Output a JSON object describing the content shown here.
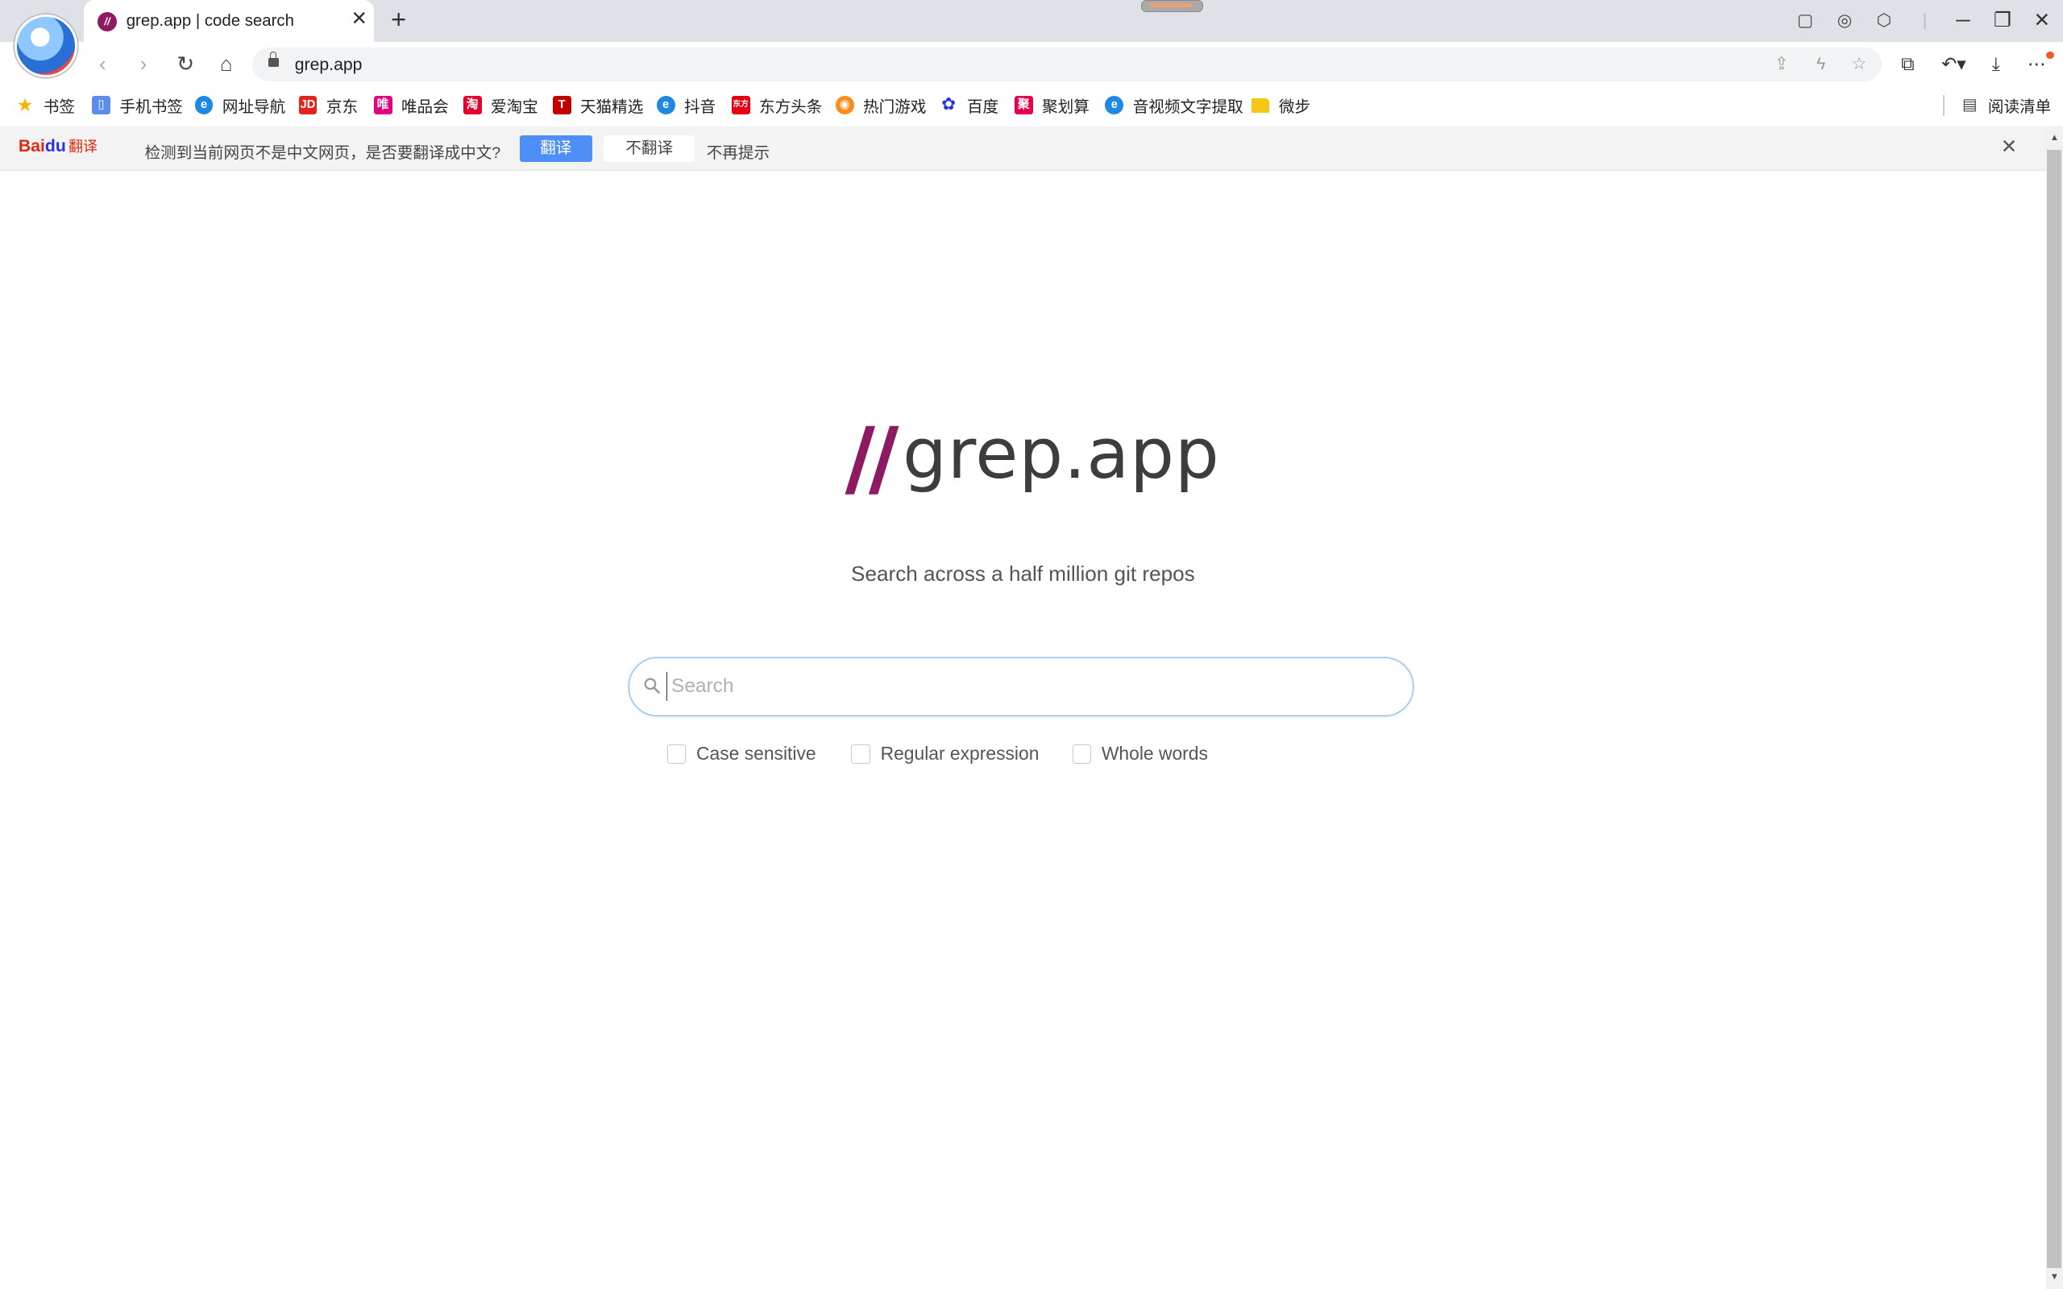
{
  "browser": {
    "tab": {
      "title": "grep.app | code search",
      "favicon_text": "//"
    },
    "url": "grep.app",
    "reading_list_label": "阅读清单"
  },
  "bookmarks": [
    {
      "label": "书签",
      "icon": "star-icon",
      "color": "#f5b400"
    },
    {
      "label": "手机书签",
      "icon": "phone-icon",
      "color": "#5b8def"
    },
    {
      "label": "网址导航",
      "icon": "ie-icon",
      "color": "#1e88e5"
    },
    {
      "label": "京东",
      "icon": "jd-icon",
      "color": "#e1251b"
    },
    {
      "label": "唯品会",
      "icon": "vip-icon",
      "color": "#e5007f"
    },
    {
      "label": "爱淘宝",
      "icon": "taobao-icon",
      "color": "#e4002b"
    },
    {
      "label": "天猫精选",
      "icon": "tmall-icon",
      "color": "#c40000"
    },
    {
      "label": "抖音",
      "icon": "ie-icon",
      "color": "#1e88e5"
    },
    {
      "label": "东方头条",
      "icon": "dftt-icon",
      "color": "#e60012"
    },
    {
      "label": "热门游戏",
      "icon": "game-icon",
      "color": "#ff8c1a"
    },
    {
      "label": "百度",
      "icon": "baidu-paw-icon",
      "color": "#2932e1"
    },
    {
      "label": "聚划算",
      "icon": "juhuasuan-icon",
      "color": "#e4004f"
    },
    {
      "label": "音视频文字提取",
      "icon": "ie-icon",
      "color": "#1e88e5"
    },
    {
      "label": "微步",
      "icon": "folder-icon",
      "color": "#f5c518"
    }
  ],
  "translate_bar": {
    "logo_bai": "Bai",
    "logo_du": "du",
    "logo_fy": "翻译",
    "message": "检测到当前网页不是中文网页，是否要翻译成中文?",
    "translate_label": "翻译",
    "no_translate_label": "不翻译",
    "never_label": "不再提示"
  },
  "page": {
    "logo_text": "grep.app",
    "tagline": "Search across a half million git repos",
    "search_placeholder": "Search",
    "options": [
      {
        "label": "Case sensitive",
        "checked": false
      },
      {
        "label": "Regular expression",
        "checked": false
      },
      {
        "label": "Whole words",
        "checked": false
      }
    ]
  },
  "colors": {
    "brand": "#8e1a62",
    "focus": "#7fb8ea",
    "translate_button": "#4e8ef7"
  }
}
